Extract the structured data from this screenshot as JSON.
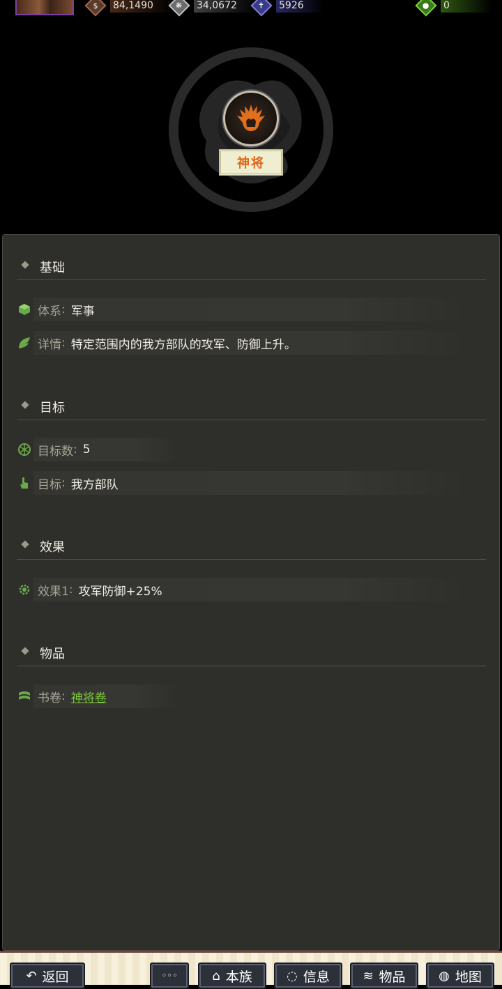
{
  "resources": [
    {
      "icon": "coin-icon",
      "value": "84,1490",
      "color": "#a06a4a"
    },
    {
      "icon": "grain-icon",
      "value": "34,0672",
      "color": "#c0c0c0"
    },
    {
      "icon": "soldier-icon",
      "value": "5926",
      "color": "#8080d0"
    },
    {
      "icon": "jade-icon",
      "value": "0",
      "color": "#7ad040"
    }
  ],
  "skill": {
    "badge": "神将",
    "icon": "flame-palm-icon",
    "emblem": "qilin-emblem"
  },
  "sections": {
    "basic": {
      "title": "基础",
      "system_label": "体系",
      "system_value": "军事",
      "detail_label": "详情",
      "detail_value": "特定范围内的我方部队的攻军、防御上升。"
    },
    "target": {
      "title": "目标",
      "count_label": "目标数",
      "count_value": "5",
      "target_label": "目标",
      "target_value": "我方部队"
    },
    "effect": {
      "title": "效果",
      "effect1_label": "效果1",
      "effect1_value": "攻军防御+25%"
    },
    "item": {
      "title": "物品",
      "book_label": "书卷",
      "book_value": "神将卷"
    }
  },
  "colon": ":",
  "nav": {
    "back": "返回",
    "more": "◦◦◦",
    "clan": "本族",
    "info": "信息",
    "items": "物品",
    "map": "地图"
  }
}
